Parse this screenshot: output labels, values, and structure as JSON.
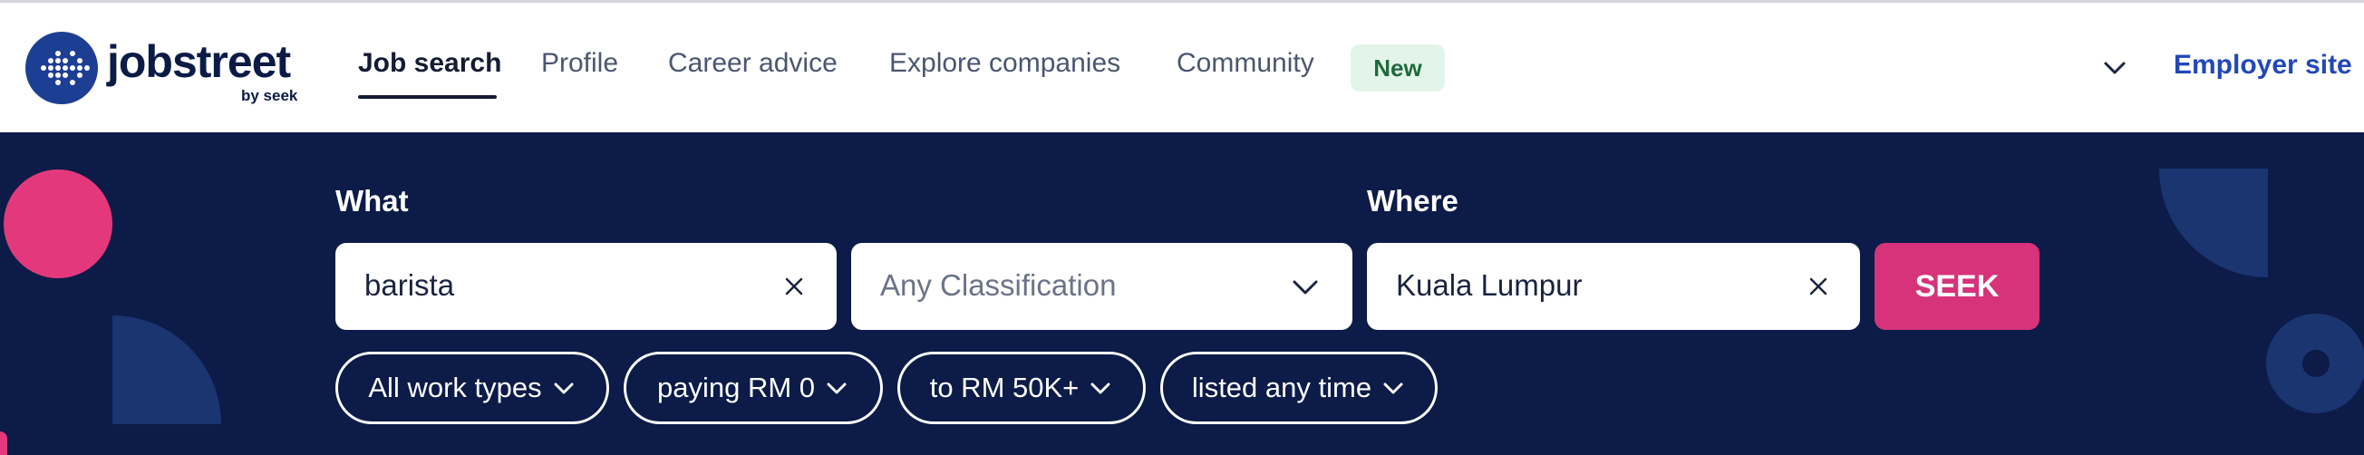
{
  "header": {
    "logo_text": "jobstreet",
    "logo_sub": "by seek",
    "nav": [
      {
        "label": "Job search"
      },
      {
        "label": "Profile"
      },
      {
        "label": "Career advice"
      },
      {
        "label": "Explore companies"
      },
      {
        "label": "Community"
      }
    ],
    "new_badge": "New",
    "employer_link": "Employer site"
  },
  "search": {
    "what_label": "What",
    "where_label": "Where",
    "keyword_value": "barista",
    "classification_value": "Any Classification",
    "location_value": "Kuala Lumpur",
    "seek_button": "SEEK"
  },
  "filters": [
    {
      "label": "All work types"
    },
    {
      "label": "paying RM 0"
    },
    {
      "label": "to RM 50K+"
    },
    {
      "label": "listed any time"
    }
  ],
  "colors": {
    "hero_bg": "#0c1b47",
    "accent_pink": "#d6337a",
    "brand_blue": "#1c3f94",
    "new_badge_bg": "#e3f5ea"
  }
}
